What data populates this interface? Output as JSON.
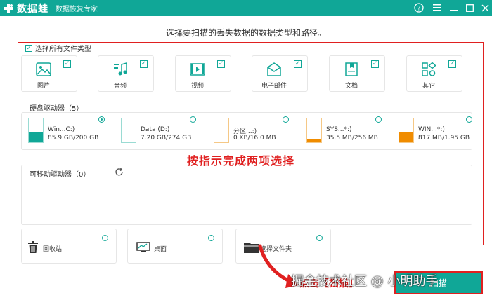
{
  "app": {
    "brand_name": "数据蛙",
    "subtitle": "数据恢复专家"
  },
  "window_controls": [
    {
      "name": "help-icon",
      "glyph": "?"
    },
    {
      "name": "menu-icon",
      "glyph": "☰"
    },
    {
      "name": "minimize-icon",
      "glyph": "—"
    },
    {
      "name": "maximize-icon",
      "glyph": "☐"
    },
    {
      "name": "close-icon",
      "glyph": "✕"
    }
  ],
  "prompt": "选择要扫描的丢失数据的数据类型和路径。",
  "select_all_label": "选择所有文件类型",
  "file_types": [
    {
      "label": "图片",
      "icon": "image-icon",
      "checked": true
    },
    {
      "label": "音频",
      "icon": "music-icon",
      "checked": true
    },
    {
      "label": "视频",
      "icon": "video-icon",
      "checked": true
    },
    {
      "label": "电子邮件",
      "icon": "email-icon",
      "checked": true
    },
    {
      "label": "文档",
      "icon": "document-icon",
      "checked": true
    },
    {
      "label": "其它",
      "icon": "other-icon",
      "checked": true
    }
  ],
  "hard_drives": {
    "title": "硬盘驱动器（5）",
    "drives": [
      {
        "name": "Win...C:)",
        "size": "85.9 GB/200 GB",
        "used": 0.43,
        "color": "#10a797",
        "selected": true
      },
      {
        "name": "Data (D:)",
        "size": "7.20 GB/274 GB",
        "used": 0.03,
        "color": "#10a797",
        "selected": false
      },
      {
        "name": "分区...:)",
        "size": "0 KB/16.0 MB",
        "used": 0.0,
        "color": "#f08c00",
        "selected": false
      },
      {
        "name": "SYS...*:)",
        "size": "35.5 MB/256 MB",
        "used": 0.14,
        "color": "#f08c00",
        "selected": false
      },
      {
        "name": "WIN...*:)",
        "size": "817 MB/1.95 GB",
        "used": 0.42,
        "color": "#f08c00",
        "selected": false
      }
    ]
  },
  "removable": {
    "title": "可移动驱动器（0）"
  },
  "locations": [
    {
      "label": "回收站",
      "icon": "recycle-bin-icon"
    },
    {
      "label": "桌面",
      "icon": "desktop-icon"
    },
    {
      "label": "选择文件夹",
      "icon": "folder-icon"
    }
  ],
  "annotation": "按指示完成两项选择",
  "scan_annotation": "点击【扫描】",
  "scan_button": "扫描",
  "watermark": "掘金技术社区 @ 小明助手",
  "colors": {
    "accent": "#10a797",
    "annotation": "#e02020",
    "warning": "#f08c00"
  }
}
